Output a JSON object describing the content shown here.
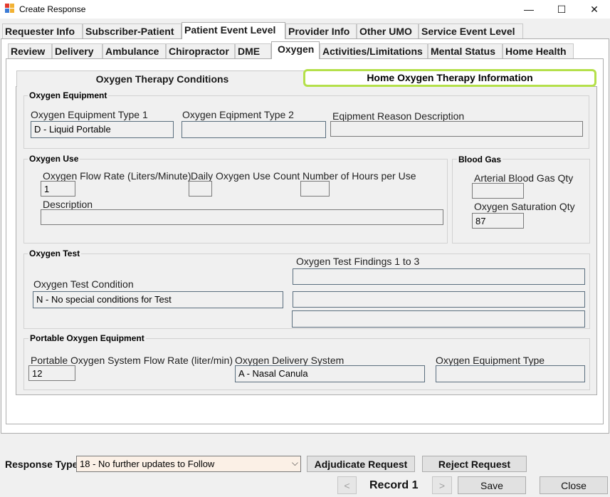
{
  "window": {
    "title": "Create Response",
    "minimize_glyph": "—",
    "maximize_glyph": "☐",
    "close_glyph": "✕"
  },
  "main_tabs": [
    {
      "label": "Requester Info"
    },
    {
      "label": "Subscriber-Patient"
    },
    {
      "label": "Patient Event Level"
    },
    {
      "label": "Provider Info"
    },
    {
      "label": "Other UMO"
    },
    {
      "label": "Service Event Level"
    }
  ],
  "event_tabs": [
    {
      "label": "Review"
    },
    {
      "label": "Delivery"
    },
    {
      "label": "Ambulance"
    },
    {
      "label": "Chiropractor"
    },
    {
      "label": "DME"
    },
    {
      "label": "Oxygen"
    },
    {
      "label": "Activities/Limitations"
    },
    {
      "label": "Mental Status"
    },
    {
      "label": "Home Health"
    }
  ],
  "oxygen_tabs": {
    "conditions": "Oxygen Therapy Conditions",
    "home": "Home Oxygen Therapy Information"
  },
  "oxygen_equipment": {
    "title": "Oxygen Equipment",
    "type1_label": "Oxygen Equipment Type 1",
    "type1_value": "D - Liquid Portable",
    "type2_label": "Oxygen Eqipment Type 2",
    "type2_value": "",
    "reason_label": "Eqipment Reason Description",
    "reason_value": ""
  },
  "oxygen_use": {
    "title": "Oxygen Use",
    "flow_label": "Oxygen Flow Rate (Liters/Minute)",
    "flow_value": "1",
    "daily_label": "Daily Oxygen Use Count",
    "daily_value": "",
    "hours_label": "Number of Hours per Use",
    "hours_value": "",
    "desc_label": "Description",
    "desc_value": ""
  },
  "blood_gas": {
    "title": "Blood Gas",
    "arterial_label": "Arterial Blood Gas Qty",
    "arterial_value": "",
    "saturation_label": "Oxygen Saturation Qty",
    "saturation_value": "87"
  },
  "oxygen_test": {
    "title": "Oxygen Test",
    "findings_label": "Oxygen Test Findings 1 to 3",
    "finding1": "",
    "finding2": "",
    "finding3": "",
    "condition_label": "Oxygen Test Condition",
    "condition_value": "N - No special conditions for Test"
  },
  "portable": {
    "title": "Portable Oxygen Equipment",
    "flow_label": "Portable Oxygen System Flow Rate (liter/min)",
    "flow_value": "12",
    "delivery_label": "Oxygen Delivery System",
    "delivery_value": "A - Nasal Canula",
    "equip_label": "Oxygen Equipment Type",
    "equip_value": ""
  },
  "bottom": {
    "response_type_label": "Response Type",
    "response_type_value": "18 - No further updates to Follow",
    "adjudicate_label": "Adjudicate Request",
    "reject_label": "Reject Request",
    "prev_glyph": "<",
    "record_label": "Record 1",
    "next_glyph": ">",
    "save_label": "Save",
    "close_label": "Close"
  },
  "colors": {
    "highlight_tab_border": "#b4e04a",
    "response_select_bg": "#fbf0e6"
  }
}
